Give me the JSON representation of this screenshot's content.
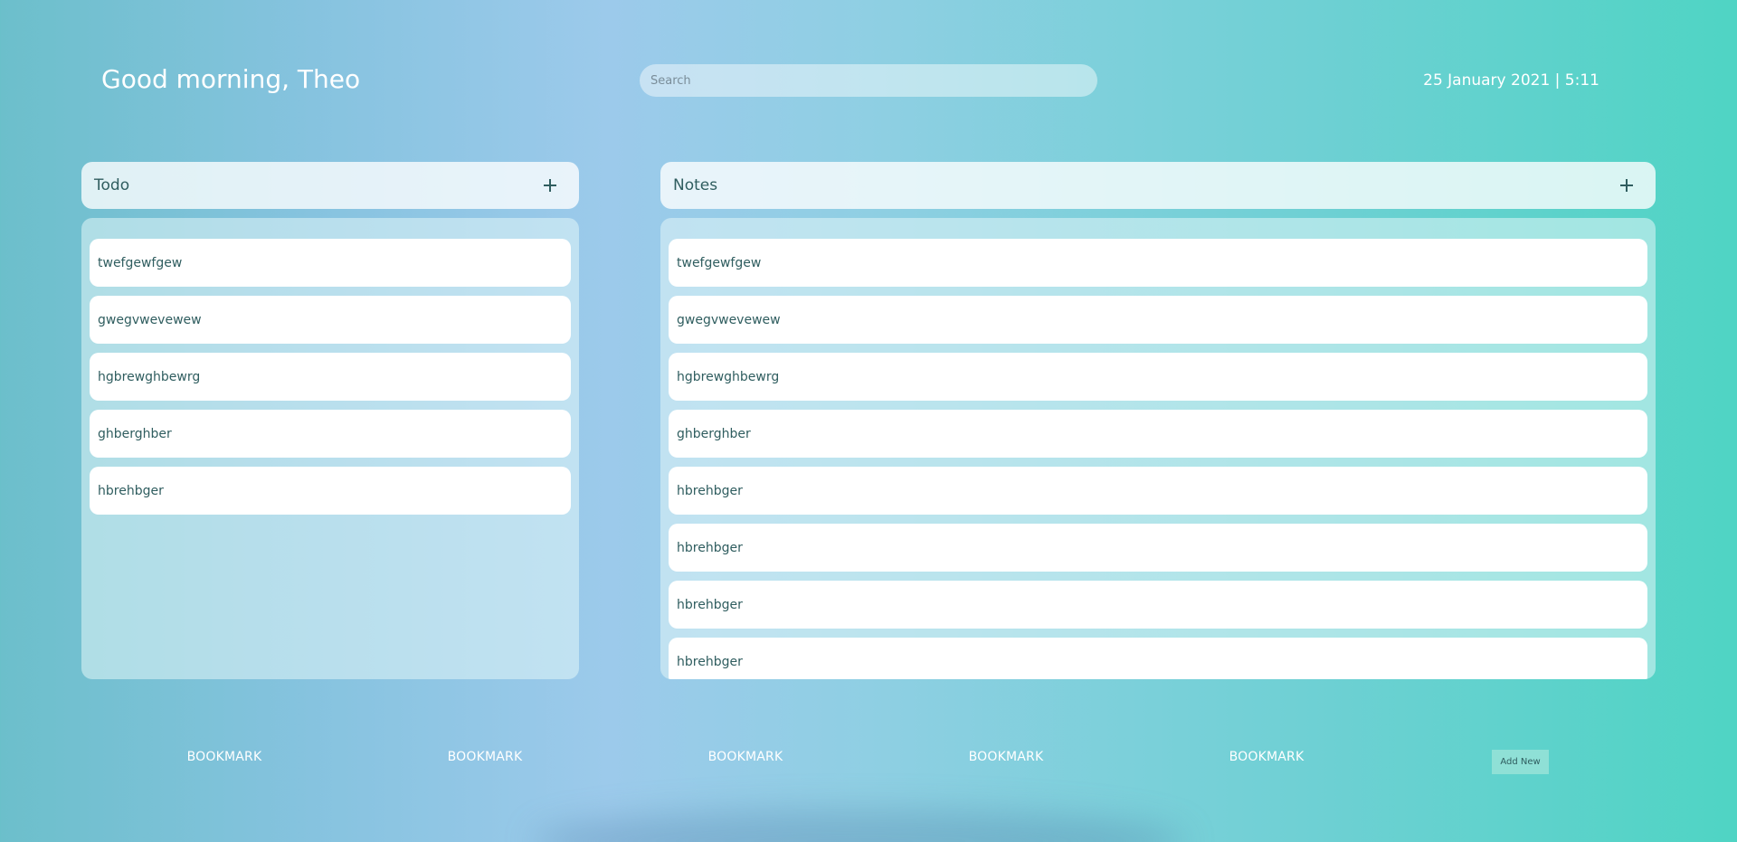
{
  "header": {
    "greeting": "Good morning, Theo",
    "search_placeholder": "Search",
    "datetime": "25 January 2021 | 5:11"
  },
  "todo": {
    "title": "Todo",
    "items": [
      "twefgewfgew",
      "gwegvwevewew",
      "hgbrewghbewrg",
      "ghberghber",
      "hbrehbger"
    ]
  },
  "notes": {
    "title": "Notes",
    "items": [
      "twefgewfgew",
      "gwegvwevewew",
      "hgbrewghbewrg",
      "ghberghber",
      "hbrehbger",
      "hbrehbger",
      "hbrehbger",
      "hbrehbger"
    ]
  },
  "bookmarks": {
    "items": [
      "BOOKMARK",
      "BOOKMARK",
      "BOOKMARK",
      "BOOKMARK",
      "BOOKMARK"
    ],
    "add_label": "Add New"
  },
  "icons": {
    "add": "plus-icon"
  },
  "colors": {
    "text_dark": "#2f5d5f",
    "accent": "#8fe0d6"
  }
}
